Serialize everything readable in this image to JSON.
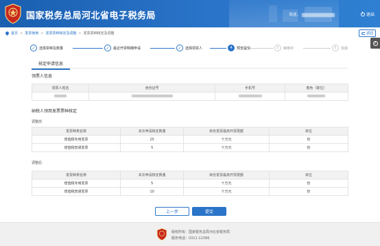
{
  "header": {
    "site_title": "国家税务总局河北省电子税务局",
    "welcome_label": "欢迎，",
    "logout_label": "退出",
    "brand_color": "#2a74c9"
  },
  "breadcrumb": {
    "items": [
      "首页",
      "发票使用",
      "发票票种核定及调整",
      "发票票种核定及调整"
    ]
  },
  "back_label": "返回",
  "steps": [
    {
      "label": "选择票种及数量",
      "state": "done"
    },
    {
      "label": "最近开票明细申请",
      "state": "done"
    },
    {
      "label": "选择领票人",
      "state": "done"
    },
    {
      "label": "预览提交",
      "state": "active",
      "num": "4"
    },
    {
      "label": "审核中",
      "state": "todo",
      "num": "5"
    },
    {
      "label": "完成",
      "state": "todo",
      "num": "6"
    }
  ],
  "tab": {
    "label": "核定申请信息"
  },
  "ticket_taker": {
    "title": "领票人信息",
    "columns": [
      "领票人姓名",
      "身份证号",
      "手机号",
      "角色（职位）"
    ]
  },
  "invoice_section": {
    "title": "纳税人领用发票票种核定",
    "before_label": "调整前",
    "after_label": "调整后",
    "columns": [
      "发票种类名称",
      "本次申请核定数量",
      "单份发票最高开票限额",
      "单位"
    ],
    "before_rows": [
      [
        "增值税专用发票",
        "25",
        "十万元",
        "份"
      ],
      [
        "增值税普通发票",
        "5",
        "十万元",
        "份"
      ]
    ],
    "after_rows": [
      [
        "增值税专用发票",
        "5",
        "十万元",
        "份"
      ],
      [
        "增值税普通发票",
        "10",
        "十万元",
        "份"
      ]
    ]
  },
  "buttons": {
    "prev": "上一步",
    "submit": "提交"
  },
  "footer": {
    "copyright": "版权所有：国家税务总局河北省税务局",
    "hotline": "服务电话：0311-12366"
  }
}
